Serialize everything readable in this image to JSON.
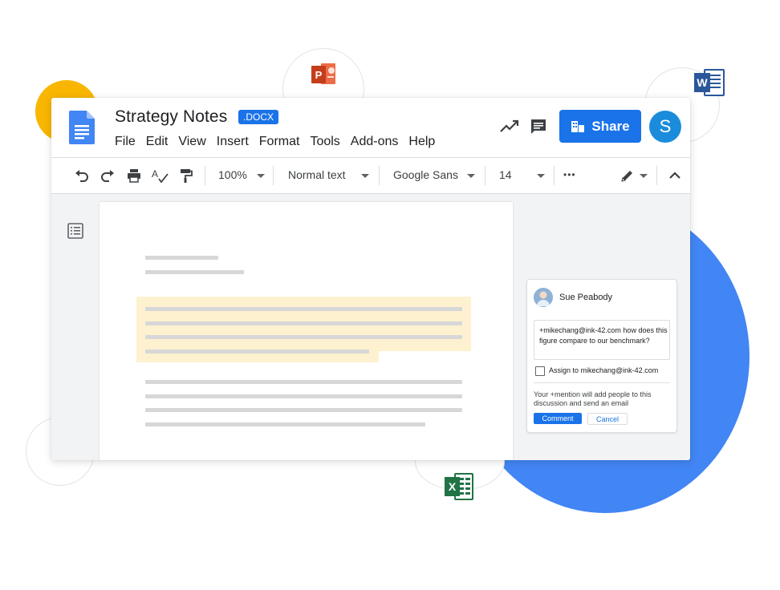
{
  "document": {
    "title": "Strategy Notes",
    "format_badge": ".DOCX"
  },
  "menu": [
    "File",
    "Edit",
    "View",
    "Insert",
    "Format",
    "Tools",
    "Add-ons",
    "Help"
  ],
  "header": {
    "share_label": "Share",
    "avatar_initial": "S"
  },
  "toolbar": {
    "zoom": "100%",
    "style": "Normal text",
    "font": "Google Sans",
    "font_size": "14",
    "more": "•••"
  },
  "comment": {
    "author": "Sue Peabody",
    "text": "+mikechang@ink-42.com how does this figure compare to our benchmark?",
    "assign_label": "Assign to mikechang@ink-42.com",
    "note": "Your +mention will add people to this discussion and send an email",
    "comment_button": "Comment",
    "cancel_button": "Cancel"
  },
  "colors": {
    "accent": "#1a73e8",
    "highlight": "#fdf1cf",
    "yellow": "#f9b600",
    "blob": "#4285f4"
  },
  "icons": [
    "docs-icon",
    "trending-icon",
    "comment-icon",
    "share-people-icon",
    "undo-icon",
    "redo-icon",
    "print-icon",
    "spellcheck-icon",
    "paint-format-icon",
    "pencil-icon",
    "collapse-icon",
    "outline-icon",
    "powerpoint-icon",
    "word-icon",
    "excel-icon"
  ]
}
